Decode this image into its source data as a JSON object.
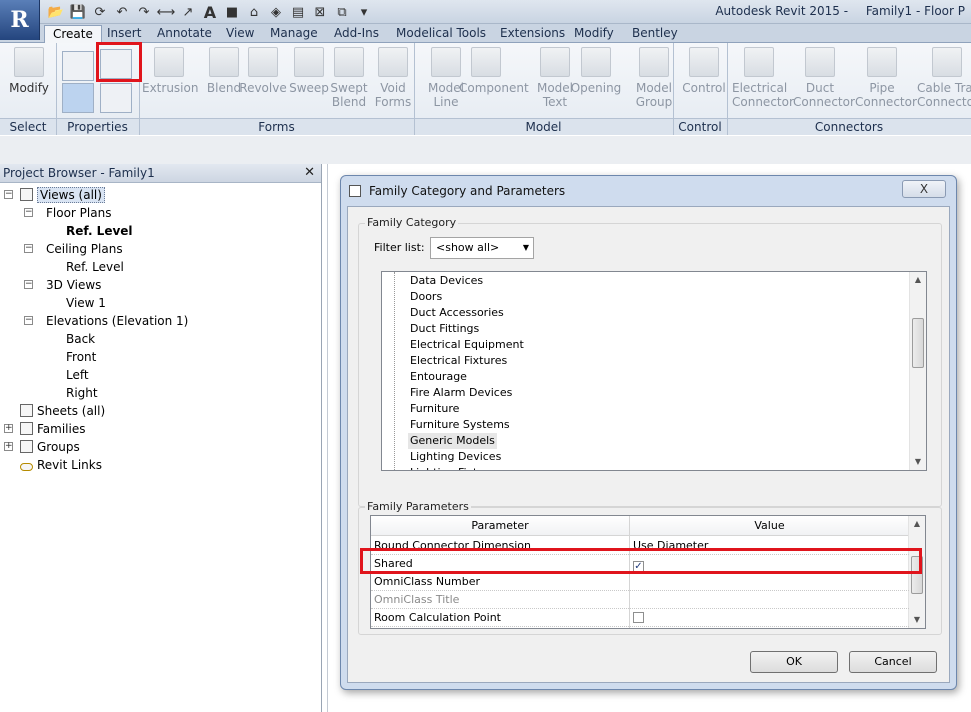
{
  "window": {
    "app_letter": "R",
    "title_app": "Autodesk Revit 2015 -",
    "title_doc": "Family1 - Floor P"
  },
  "qat_icons": [
    "open-icon",
    "save-icon",
    "sync-icon",
    "undo-icon",
    "redo-icon",
    "measure-icon",
    "dimension-icon",
    "text-icon",
    "3d-view-icon",
    "section-icon",
    "thin-lines-icon",
    "close-hidden-icon",
    "switch-windows-icon",
    "customize-qat-icon"
  ],
  "qat_text_glyph": "A",
  "ribbon": {
    "tabs": [
      "Create",
      "Insert",
      "Annotate",
      "View",
      "Manage",
      "Add-Ins",
      "Modelical Tools",
      "Extensions",
      "Modify",
      "Bentley"
    ],
    "active_tab": "Create",
    "buttons": [
      {
        "label": "Modify",
        "enabled": true
      },
      {
        "label": "Extrusion",
        "enabled": false
      },
      {
        "label": "Blend",
        "enabled": false
      },
      {
        "label": "Revolve",
        "enabled": false
      },
      {
        "label": "Sweep",
        "enabled": false
      },
      {
        "label": "Swept\nBlend",
        "enabled": false
      },
      {
        "label": "Void\nForms",
        "enabled": false
      },
      {
        "label": "Model\nLine",
        "enabled": false
      },
      {
        "label": "Component",
        "enabled": false
      },
      {
        "label": "Model\nText",
        "enabled": false
      },
      {
        "label": "Opening",
        "enabled": false
      },
      {
        "label": "Model\nGroup",
        "enabled": false
      },
      {
        "label": "Control",
        "enabled": false
      },
      {
        "label": "Electrical\nConnector",
        "enabled": false
      },
      {
        "label": "Duct\nConnector",
        "enabled": false
      },
      {
        "label": "Pipe\nConnector",
        "enabled": false
      },
      {
        "label": "Cable Tray\nConnector",
        "enabled": false
      }
    ],
    "panels": [
      "Select",
      "Properties",
      "Forms",
      "Model",
      "Control",
      "Connectors"
    ]
  },
  "project_browser": {
    "title": "Project Browser - Family1",
    "tree": [
      {
        "label": "Views (all)",
        "level": 0,
        "expander": "-",
        "icon": "views-icon",
        "selected": true
      },
      {
        "label": "Floor Plans",
        "level": 1,
        "expander": "-"
      },
      {
        "label": "Ref. Level",
        "level": 2,
        "bold": true
      },
      {
        "label": "Ceiling Plans",
        "level": 1,
        "expander": "-"
      },
      {
        "label": "Ref. Level",
        "level": 2
      },
      {
        "label": "3D Views",
        "level": 1,
        "expander": "-"
      },
      {
        "label": "View 1",
        "level": 2
      },
      {
        "label": "Elevations (Elevation 1)",
        "level": 1,
        "expander": "-"
      },
      {
        "label": "Back",
        "level": 2
      },
      {
        "label": "Front",
        "level": 2
      },
      {
        "label": "Left",
        "level": 2
      },
      {
        "label": "Right",
        "level": 2
      },
      {
        "label": "Sheets (all)",
        "level": 0,
        "icon": "sheets-icon"
      },
      {
        "label": "Families",
        "level": 0,
        "expander": "+",
        "icon": "families-icon"
      },
      {
        "label": "Groups",
        "level": 0,
        "expander": "+",
        "icon": "groups-icon"
      },
      {
        "label": "Revit Links",
        "level": 0,
        "icon": "links-icon"
      }
    ]
  },
  "dialog": {
    "title": "Family Category and Parameters",
    "category_group": "Family Category",
    "filter_label": "Filter list:",
    "filter_value": "<show all>",
    "categories": [
      "Data Devices",
      "Doors",
      "Duct Accessories",
      "Duct Fittings",
      "Electrical Equipment",
      "Electrical Fixtures",
      "Entourage",
      "Fire Alarm Devices",
      "Furniture",
      "Furniture Systems",
      "Generic Models",
      "Lighting Devices",
      "Lighting Fixtures"
    ],
    "selected_category": "Generic Models",
    "params_group": "Family Parameters",
    "columns": [
      "Parameter",
      "Value"
    ],
    "params": [
      {
        "name": "Round Connector Dimension",
        "value": "Use Diameter",
        "type": "text"
      },
      {
        "name": "Shared",
        "value": "",
        "type": "checkbox",
        "checked": true
      },
      {
        "name": "OmniClass Number",
        "value": "",
        "type": "text"
      },
      {
        "name": "OmniClass Title",
        "value": "",
        "type": "text",
        "disabled": true
      },
      {
        "name": "Room Calculation Point",
        "value": "",
        "type": "checkbox",
        "checked": false
      }
    ],
    "ok": "OK",
    "cancel": "Cancel",
    "close": "X"
  },
  "colors": {
    "highlight_red": "#e0141c",
    "dialog_frame": "#cfdcee"
  }
}
